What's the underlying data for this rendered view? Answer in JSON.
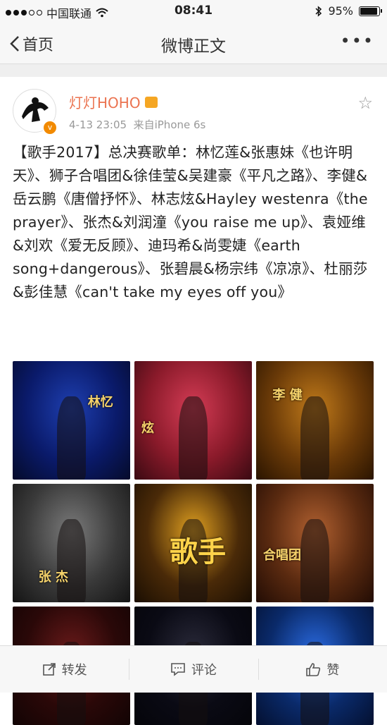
{
  "status_bar": {
    "carrier": "中国联通",
    "time": "08:41",
    "battery": "95%",
    "battery_level": 0.95
  },
  "nav": {
    "back_label": "首页",
    "title": "微博正文"
  },
  "post": {
    "username": "灯灯HOHO",
    "timestamp": "4-13 23:05",
    "source": "来自iPhone 6s",
    "text": "【歌手2017】总决赛歌单：林忆莲&张惠妹《也许明天》、狮子合唱团&徐佳莹&吴建豪《平凡之路》、李健&岳云鹏《唐僧抒怀》、林志炫&Hayley westenra《the prayer》、张杰&刘润潼《you raise me up》、袁娅维&刘欢《爱无反顾》、迪玛希&尚雯婕《earth song+dangerous》、张碧晨&杨宗纬《凉凉》、杜丽莎&彭佳慧《can't take my eyes off you》",
    "images": [
      {
        "label": "林忆",
        "colors": [
          "#0a1a6a",
          "#1e3fb0",
          "#050b2a"
        ]
      },
      {
        "label": "炫",
        "colors": [
          "#8a1a2a",
          "#d43c55",
          "#3a0a12"
        ]
      },
      {
        "label": "李 健",
        "colors": [
          "#6a3a08",
          "#c07a1a",
          "#2a1400"
        ]
      },
      {
        "label": "张 杰",
        "colors": [
          "#3a3a3a",
          "#7a7a7a",
          "#141414"
        ]
      },
      {
        "label": "歌手",
        "colors": [
          "#4a2a08",
          "#e0a020",
          "#1a0e02"
        ]
      },
      {
        "label": "合唱团",
        "colors": [
          "#5a2a10",
          "#b06030",
          "#220c04"
        ]
      },
      {
        "label": "",
        "colors": [
          "#2a0808",
          "#6a1a1a",
          "#120404"
        ]
      },
      {
        "label": "",
        "colors": [
          "#0a0a14",
          "#2a2a3a",
          "#05050a"
        ]
      },
      {
        "label": "",
        "colors": [
          "#0a2a6a",
          "#2a6ae0",
          "#041030"
        ]
      }
    ]
  },
  "actions": {
    "repost": "转发",
    "comment": "评论",
    "like": "赞"
  },
  "colors": {
    "accent": "#eb7350",
    "meta": "#999999"
  }
}
